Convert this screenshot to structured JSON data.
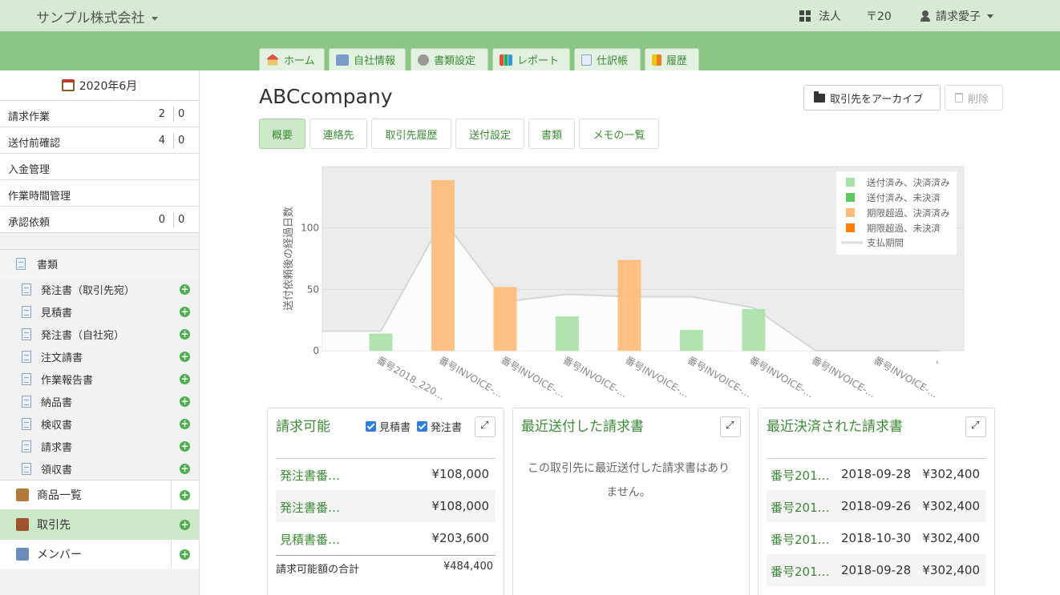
{
  "header": {
    "company": "サンプル株式会社",
    "nav_corp": "法人",
    "nav_postal": "〒20",
    "user": "請求愛子"
  },
  "tabs": [
    {
      "label": "ホーム",
      "icon": "home-icon"
    },
    {
      "label": "自社情報",
      "icon": "org-chart-icon"
    },
    {
      "label": "書類設定",
      "icon": "gear-icon"
    },
    {
      "label": "レポート",
      "icon": "bar-chart-icon"
    },
    {
      "label": "仕訳帳",
      "icon": "ledger-icon"
    },
    {
      "label": "履歴",
      "icon": "history-icon"
    }
  ],
  "sidebar": {
    "month": "2020年6月",
    "tasks": [
      {
        "label": "請求作業",
        "n1": "2",
        "n2": "0"
      },
      {
        "label": "送付前確認",
        "n1": "4",
        "n2": "0"
      },
      {
        "label": "入金管理",
        "n1": "",
        "n2": ""
      },
      {
        "label": "作業時間管理",
        "n1": "",
        "n2": ""
      },
      {
        "label": "承認依頼",
        "n1": "0",
        "n2": "0"
      }
    ],
    "docs_section": "書類",
    "docs": [
      "発注書（取引先宛）",
      "見積書",
      "発注書（自社宛）",
      "注文請書",
      "作業報告書",
      "納品書",
      "検収書",
      "請求書",
      "領収書"
    ],
    "main_items": [
      {
        "label": "商品一覧",
        "icon": "product-list-icon"
      },
      {
        "label": "取引先",
        "icon": "client-person-icon",
        "active": true
      },
      {
        "label": "メンバー",
        "icon": "member-card-icon"
      }
    ]
  },
  "main": {
    "title": "ABCcompany",
    "archive_button": "取引先をアーカイブ",
    "delete_button": "削除",
    "subtabs": [
      "概要",
      "連絡先",
      "取引先履歴",
      "送付設定",
      "書類",
      "メモの一覧"
    ]
  },
  "chart_data": {
    "type": "bar",
    "ylabel": "送付依頼後の経過日数",
    "ylim": [
      0,
      150
    ],
    "yticks": [
      0,
      50,
      100
    ],
    "categories": [
      "番号2018_220…",
      "番号INVOICE-…",
      "番号INVOICE-…",
      "番号INVOICE-…",
      "番号INVOICE-…",
      "番号INVOICE-…",
      "番号INVOICE-…",
      "番号INVOICE-…",
      "番号INVOICE-…",
      "、"
    ],
    "series": [
      {
        "name": "送付済み、決済済み",
        "color": "#a8e0a6",
        "values": [
          14,
          0,
          0,
          28,
          0,
          17,
          34,
          0,
          0,
          0
        ]
      },
      {
        "name": "送付済み、未決済",
        "color": "#5ec95e",
        "values": [
          0,
          0,
          0,
          0,
          0,
          0,
          0,
          0,
          0,
          0
        ]
      },
      {
        "name": "期限超過、決済済み",
        "color": "#ffbb77",
        "values": [
          0,
          139,
          52,
          0,
          74,
          0,
          0,
          0,
          0,
          0
        ]
      },
      {
        "name": "期限超過、未決済",
        "color": "#ff8000",
        "values": [
          0,
          0,
          0,
          0,
          0,
          0,
          0,
          0,
          0,
          0
        ]
      }
    ],
    "line": {
      "name": "支払期間",
      "values": [
        16,
        107,
        40,
        46,
        44,
        44,
        35,
        0,
        0,
        0
      ]
    },
    "legend": "top-right"
  },
  "panels": {
    "billable": {
      "title": "請求可能",
      "check1": "見積書",
      "check2": "発注書",
      "rows": [
        {
          "link": "発注書番…",
          "amount": "¥108,000"
        },
        {
          "link": "発注書番…",
          "amount": "¥108,000"
        },
        {
          "link": "見積書番…",
          "amount": "¥203,600"
        }
      ],
      "total_label": "請求可能額の合計",
      "total_amount": "¥484,400"
    },
    "recent_sent": {
      "title": "最近送付した請求書",
      "empty_line1": "この取引先に最近送付した請求書はあり",
      "empty_line2": "ません。"
    },
    "recent_settled": {
      "title": "最近決済された請求書",
      "rows": [
        {
          "link": "番号201…",
          "date": "2018-09-28",
          "amount": "¥302,400"
        },
        {
          "link": "番号201…",
          "date": "2018-09-26",
          "amount": "¥302,400"
        },
        {
          "link": "番号201…",
          "date": "2018-10-30",
          "amount": "¥302,400"
        },
        {
          "link": "番号201…",
          "date": "2018-09-28",
          "amount": "¥302,400"
        }
      ]
    }
  }
}
